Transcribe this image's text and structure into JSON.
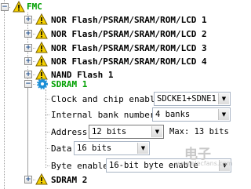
{
  "root": {
    "label": "FMC",
    "expander": "−"
  },
  "nodes": [
    {
      "label": "NOR Flash/PSRAM/SRAM/ROM/LCD 1",
      "expander": "+"
    },
    {
      "label": "NOR Flash/PSRAM/SRAM/ROM/LCD 2",
      "expander": "+"
    },
    {
      "label": "NOR Flash/PSRAM/SRAM/ROM/LCD 3",
      "expander": "+"
    },
    {
      "label": "NOR Flash/PSRAM/SRAM/ROM/LCD 4",
      "expander": "+"
    },
    {
      "label": "NAND Flash 1",
      "expander": "+"
    },
    {
      "label": "SDRAM 1",
      "expander": "−"
    },
    {
      "label": "SDRAM 2",
      "expander": "+"
    }
  ],
  "sdram1": {
    "clock": {
      "label": "Clock and chip enable",
      "value": "SDCKE1+SDNE1"
    },
    "banks": {
      "label": "Internal bank number",
      "value": "4 banks"
    },
    "address": {
      "label": "Address",
      "value": "12 bits",
      "max": "Max: 13 bits"
    },
    "data": {
      "label": "Data",
      "value": "16 bits"
    },
    "byte": {
      "label": "Byte enable",
      "value": "16-bit byte enable"
    }
  },
  "watermark": {
    "text": "电子",
    "url": "www.elecfans.com"
  },
  "icons": {
    "expand": "plus-icon",
    "collapse": "minus-icon",
    "node": "warning-icon",
    "ok": "gear-icon",
    "dropdown": "chevron-down-icon"
  },
  "colors": {
    "active_node": "#00a000",
    "warning": "#f5d000"
  }
}
